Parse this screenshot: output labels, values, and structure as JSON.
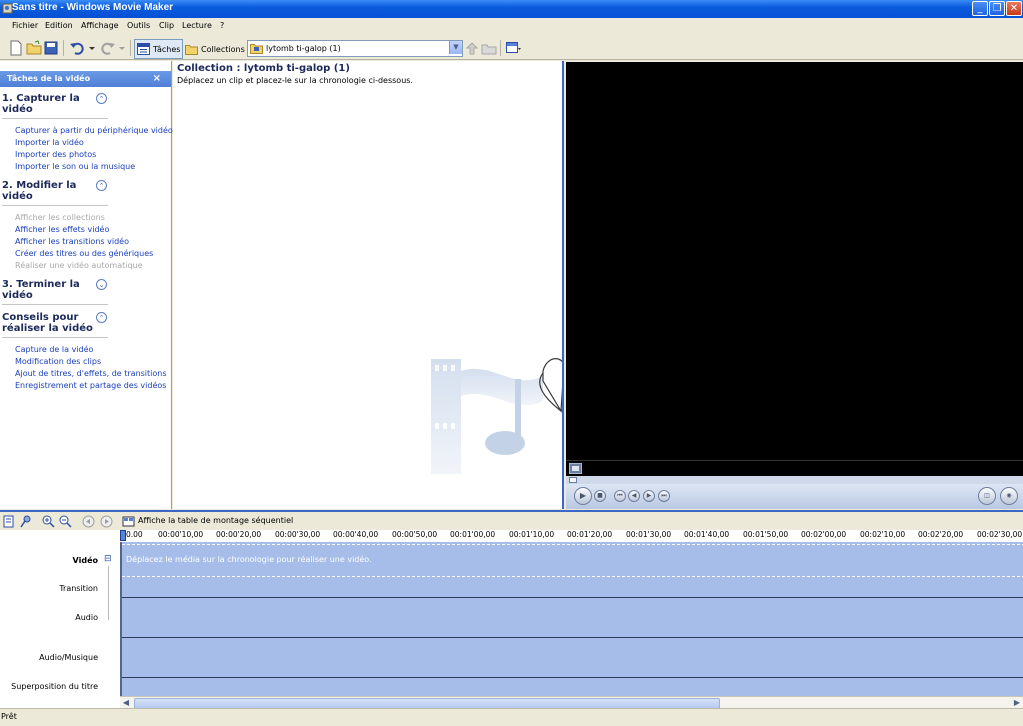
{
  "window": {
    "title": "Sans titre - Windows Movie Maker",
    "controls": {
      "minimize": "_",
      "maximize": "❐",
      "close": "✕"
    }
  },
  "menu": [
    "Fichier",
    "Edition",
    "Affichage",
    "Outils",
    "Clip",
    "Lecture",
    "?"
  ],
  "toolbar": {
    "tasks_label": "Tâches",
    "collections_label": "Collections",
    "collection_select_value": "lytomb ti-galop (1)"
  },
  "task_pane": {
    "header": "Tâches de la vidéo",
    "close_glyph": "×",
    "sections": [
      {
        "title": "1. Capturer la vidéo",
        "toggle": "⌃",
        "items": [
          {
            "label": "Capturer à partir du périphérique vidéo",
            "enabled": true
          },
          {
            "label": "Importer la vidéo",
            "enabled": true
          },
          {
            "label": "Importer des photos",
            "enabled": true
          },
          {
            "label": "Importer le son ou la musique",
            "enabled": true
          }
        ]
      },
      {
        "title": "2. Modifier la vidéo",
        "toggle": "⌃",
        "items": [
          {
            "label": "Afficher les collections",
            "enabled": false
          },
          {
            "label": "Afficher les effets vidéo",
            "enabled": true
          },
          {
            "label": "Afficher les transitions vidéo",
            "enabled": true
          },
          {
            "label": "Créer des titres ou des génériques",
            "enabled": true
          },
          {
            "label": "Réaliser une vidéo automatique",
            "enabled": false
          }
        ]
      },
      {
        "title": "3. Terminer la vidéo",
        "toggle": "⌄",
        "items": []
      },
      {
        "title": "Conseils pour réaliser la vidéo",
        "toggle": "⌃",
        "items": [
          {
            "label": "Capture de la vidéo",
            "enabled": true
          },
          {
            "label": "Modification des clips",
            "enabled": true
          },
          {
            "label": "Ajout de titres, d'effets, de transitions",
            "enabled": true
          },
          {
            "label": "Enregistrement et partage des vidéos",
            "enabled": true
          }
        ]
      }
    ]
  },
  "collection": {
    "title": "Collection : lytomb ti-galop (1)",
    "subtitle": "Déplacez un clip et placez-le sur la chronologie ci-dessous."
  },
  "timeline": {
    "storyboard_label": "Affiche la table de montage séquentiel",
    "tracks": [
      "Vidéo",
      "Transition",
      "Audio",
      "Audio/Musique",
      "Superposition du titre"
    ],
    "expand_glyph": "⊟",
    "ruler": [
      "0.00",
      "00:00'10,00",
      "00:00'20,00",
      "00:00'30,00",
      "00:00'40,00",
      "00:00'50,00",
      "00:01'00,00",
      "00:01'10,00",
      "00:01'20,00",
      "00:01'30,00",
      "00:01'40,00",
      "00:01'50,00",
      "00:02'00,00",
      "00:02'10,00",
      "00:02'20,00",
      "00:02'30,00"
    ],
    "hint": "Déplacez le média sur la chronologie pour réaliser une vidéo."
  },
  "status": "Prêt",
  "colors": {
    "titlebar": "#0a5bdb",
    "link": "#1a3fbb",
    "track": "#a5bde8",
    "preview": "#000000"
  }
}
